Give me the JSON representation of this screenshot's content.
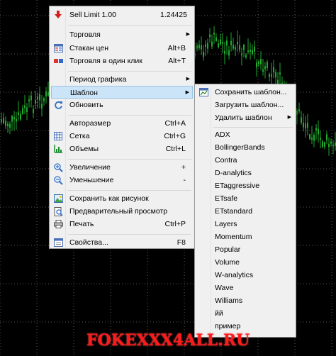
{
  "colors": {
    "chart_bg": "#000000",
    "grid": "#5a5a5a",
    "candle": "#22a82e",
    "menu_bg": "#f0f0f0",
    "highlight": "#cce4f7",
    "watermark": "#ff1a1a"
  },
  "main_menu": {
    "sell_limit": {
      "label": "Sell Limit 1.00",
      "value": "1.24425",
      "icon": "red-down-arrow-icon"
    },
    "trading": {
      "label": "Торговля"
    },
    "depth": {
      "label": "Стакан цен",
      "shortcut": "Alt+B",
      "icon": "depth-of-market-icon"
    },
    "one_click": {
      "label": "Торговля в один клик",
      "shortcut": "Alt+T",
      "icon": "one-click-trading-icon"
    },
    "timeframe": {
      "label": "Период графика"
    },
    "template": {
      "label": "Шаблон"
    },
    "refresh": {
      "label": "Обновить",
      "icon": "refresh-icon"
    },
    "autoscroll": {
      "label": "Авторазмер",
      "shortcut": "Ctrl+A"
    },
    "grid": {
      "label": "Сетка",
      "shortcut": "Ctrl+G",
      "icon": "grid-icon"
    },
    "volumes": {
      "label": "Объемы",
      "shortcut": "Ctrl+L",
      "icon": "volumes-icon"
    },
    "zoom_in": {
      "label": "Увеличение",
      "shortcut": "+",
      "icon": "zoom-in-icon"
    },
    "zoom_out": {
      "label": "Уменьшение",
      "shortcut": "-",
      "icon": "zoom-out-icon"
    },
    "save_picture": {
      "label": "Сохранить как рисунок",
      "icon": "save-picture-icon"
    },
    "print_preview": {
      "label": "Предварительный просмотр",
      "icon": "print-preview-icon"
    },
    "print": {
      "label": "Печать",
      "shortcut": "Ctrl+P",
      "icon": "print-icon"
    },
    "properties": {
      "label": "Свойства...",
      "shortcut": "F8",
      "icon": "properties-icon"
    }
  },
  "template_menu": {
    "save": {
      "label": "Сохранить шаблон...",
      "icon": "save-template-icon"
    },
    "load": {
      "label": "Загрузить шаблон..."
    },
    "remove": {
      "label": "Удалить шаблон"
    },
    "templates": [
      "ADX",
      "BollingerBands",
      "Contra",
      "D-analytics",
      "ETaggressive",
      "ETsafe",
      "ETstandard",
      "Layers",
      "Momentum",
      "Popular",
      "Volume",
      "W-analytics",
      "Wave",
      "Williams",
      "йй",
      "пример"
    ]
  },
  "watermark": {
    "text": "FOKEXXX4ALL.RU"
  }
}
